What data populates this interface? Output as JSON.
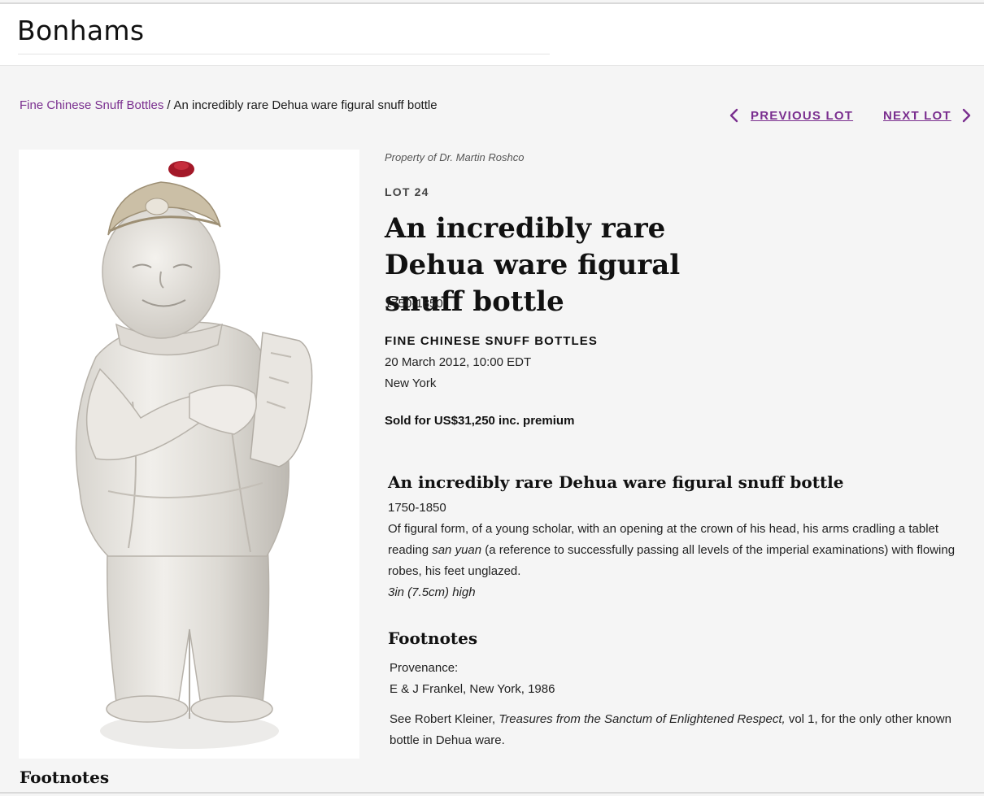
{
  "brand": {
    "logo_text": "Bonhams"
  },
  "breadcrumb": {
    "parent": "Fine Chinese Snuff Bottles",
    "separator": "/",
    "current": "An incredibly rare Dehua ware figural snuff bottle"
  },
  "lot_nav": {
    "previous_label": "PREVIOUS LOT",
    "next_label": "NEXT LOT",
    "previous_icon": "chevron-left-icon",
    "next_icon": "chevron-right-icon"
  },
  "lot": {
    "owner": "Property of Dr. Martin Roshco",
    "number": "LOT 24",
    "title": "An incredibly rare Dehua ware figural snuff bottle",
    "date": "1750-1850"
  },
  "sale": {
    "name": "FINE CHINESE SNUFF BOTTLES",
    "when": "20 March 2012, 10:00 EDT",
    "where": "New York",
    "sold": "Sold for US$31,250 inc. premium"
  },
  "description": {
    "title": "An incredibly rare Dehua ware figural snuff bottle",
    "date": "1750-1850",
    "body_start": "Of figural form, of a young scholar, with an opening at the crown of his head, his arms cradling a tablet reading ",
    "body_italic": "san yuan",
    "body_end": " (a reference to successfully passing all levels of the imperial examinations) with flowing robes, his feet unglazed.",
    "dimensions": "3in (7.5cm) high"
  },
  "footnotes": {
    "heading": "Footnotes",
    "provenance_label": "Provenance:",
    "provenance_value": "E & J Frankel, New York, 1986",
    "see_start": "See Robert Kleiner, ",
    "see_italic": "Treasures from the Sanctum of Enlightened Respect,",
    "see_end": " vol 1, for the only other known bottle in Dehua ware."
  },
  "bottom": {
    "footnotes_heading": "Footnotes"
  },
  "colors": {
    "accent": "#7a2f8f",
    "background": "#f5f5f5",
    "header": "#ffffff",
    "text": "#1a1a1a"
  }
}
